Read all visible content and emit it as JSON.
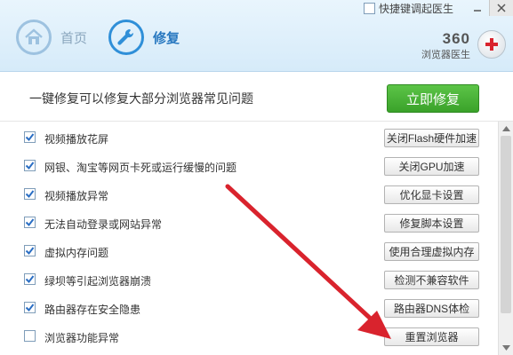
{
  "topbar": {
    "quick_launch_label": "快捷键调起医生",
    "minimize": "—",
    "close": "✕"
  },
  "nav": {
    "home_label": "首页",
    "repair_label": "修复"
  },
  "brand": {
    "number": "360",
    "subtitle": "浏览器医生"
  },
  "banner": {
    "text": "一键修复可以修复大部分浏览器常见问题",
    "fix_button": "立即修复"
  },
  "issues": [
    {
      "label": "视频播放花屏",
      "button": "关闭Flash硬件加速",
      "checked": true
    },
    {
      "label": "网银、淘宝等网页卡死或运行缓慢的问题",
      "button": "关闭GPU加速",
      "checked": true
    },
    {
      "label": "视频播放异常",
      "button": "优化显卡设置",
      "checked": true
    },
    {
      "label": "无法自动登录或网站异常",
      "button": "修复脚本设置",
      "checked": true
    },
    {
      "label": "虚拟内存问题",
      "button": "使用合理虚拟内存",
      "checked": true
    },
    {
      "label": "绿坝等引起浏览器崩溃",
      "button": "检测不兼容软件",
      "checked": true
    },
    {
      "label": "路由器存在安全隐患",
      "button": "路由器DNS体检",
      "checked": true
    },
    {
      "label": "浏览器功能异常",
      "button": "重置浏览器",
      "checked": false
    }
  ],
  "colors": {
    "accent": "#2f8fd8",
    "green": "#3aa22a",
    "arrow": "#d9232d",
    "check": "#2a6ec4"
  }
}
